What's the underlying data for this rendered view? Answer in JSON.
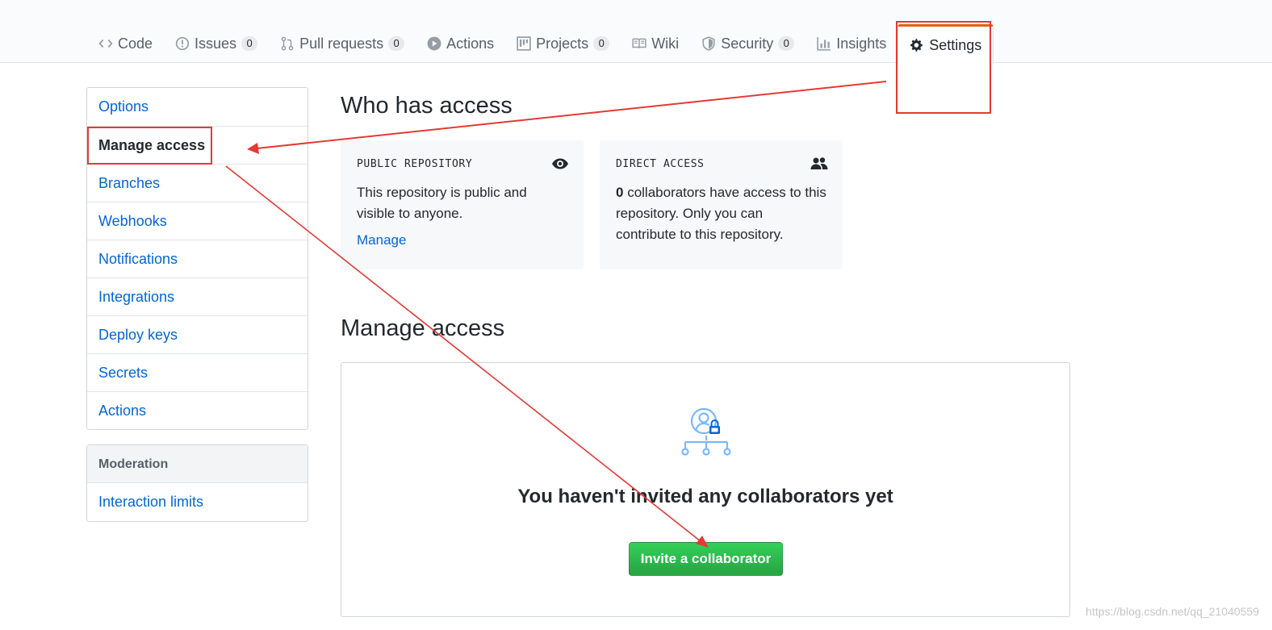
{
  "tabs": [
    {
      "label": "Code",
      "icon": "code-icon"
    },
    {
      "label": "Issues",
      "icon": "issue-icon",
      "count": "0"
    },
    {
      "label": "Pull requests",
      "icon": "pull-request-icon",
      "count": "0"
    },
    {
      "label": "Actions",
      "icon": "play-icon"
    },
    {
      "label": "Projects",
      "icon": "project-icon",
      "count": "0"
    },
    {
      "label": "Wiki",
      "icon": "book-icon"
    },
    {
      "label": "Security",
      "icon": "shield-icon",
      "count": "0"
    },
    {
      "label": "Insights",
      "icon": "graph-icon"
    },
    {
      "label": "Settings",
      "icon": "gear-icon",
      "selected": true
    }
  ],
  "menu": {
    "items": [
      "Options",
      "Manage access",
      "Branches",
      "Webhooks",
      "Notifications",
      "Integrations",
      "Deploy keys",
      "Secrets",
      "Actions"
    ],
    "selected": "Manage access",
    "moderation_heading": "Moderation",
    "moderation_items": [
      "Interaction limits"
    ]
  },
  "who_has_access": {
    "title": "Who has access",
    "public_card": {
      "title": "PUBLIC REPOSITORY",
      "icon": "eye-icon",
      "text": "This repository is public and visible to anyone.",
      "link": "Manage"
    },
    "direct_card": {
      "title": "DIRECT ACCESS",
      "icon": "people-icon",
      "count": "0",
      "text": " collaborators have access to this repository. Only you can contribute to this repository."
    }
  },
  "manage_access": {
    "title": "Manage access",
    "icon": "person-lock-org-icon",
    "empty_message": "You haven't invited any collaborators yet",
    "button_label": "Invite a collaborator"
  },
  "colors": {
    "link": "#0366d6",
    "selected_tab_accent": "#e36209",
    "invite_button": "#28a745",
    "annotation": "#e53935"
  },
  "watermark": "https://blog.csdn.net/qq_21040559"
}
